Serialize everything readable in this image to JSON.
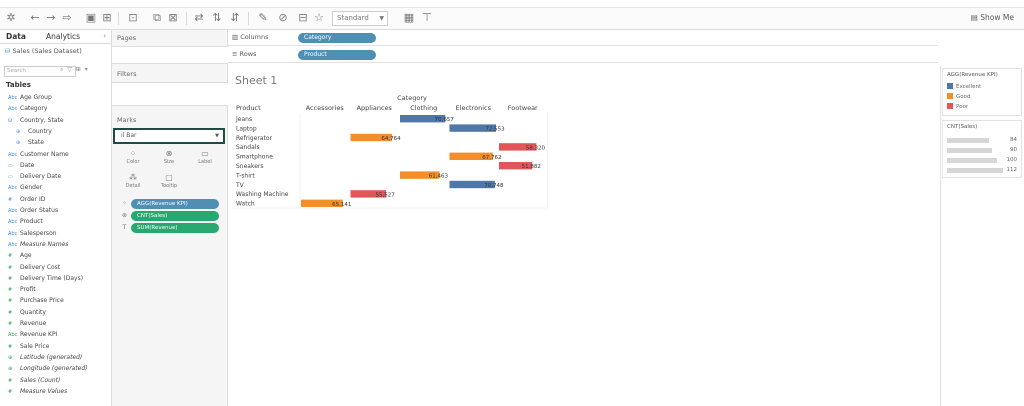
{
  "toolbar": {
    "mark_size": "Standard",
    "show_me": "Show Me"
  },
  "data_pane": {
    "tabs": [
      "Data",
      "Analytics"
    ],
    "datasource": "Sales (Sales Dataset)",
    "search_placeholder": "Search",
    "tables_label": "Tables",
    "fields": [
      {
        "icon": "Abc",
        "name": "Age Group",
        "type": "dim"
      },
      {
        "icon": "Abc",
        "name": "Category",
        "type": "dim"
      },
      {
        "icon": "⛁",
        "name": "Country, State",
        "type": "dim"
      },
      {
        "icon": "⊕",
        "name": "Country",
        "type": "geo"
      },
      {
        "icon": "⊕",
        "name": "State",
        "type": "geo"
      },
      {
        "icon": "Abc",
        "name": "Customer Name",
        "type": "dim"
      },
      {
        "icon": "▭",
        "name": "Date",
        "type": "dim"
      },
      {
        "icon": "▭",
        "name": "Delivery Date",
        "type": "dim"
      },
      {
        "icon": "Abc",
        "name": "Gender",
        "type": "dim"
      },
      {
        "icon": "#",
        "name": "Order ID",
        "type": "dim"
      },
      {
        "icon": "Abc",
        "name": "Order Status",
        "type": "dim"
      },
      {
        "icon": "Abc",
        "name": "Product",
        "type": "dim"
      },
      {
        "icon": "Abc",
        "name": "Salesperson",
        "type": "dim"
      },
      {
        "icon": "Abc",
        "name": "Measure Names",
        "type": "dim",
        "italic": true
      },
      {
        "icon": "#",
        "name": "Age",
        "type": "mea"
      },
      {
        "icon": "#",
        "name": "Delivery Cost",
        "type": "mea"
      },
      {
        "icon": "#",
        "name": "Delivery Time (Days)",
        "type": "mea"
      },
      {
        "icon": "#",
        "name": "Profit",
        "type": "mea"
      },
      {
        "icon": "#",
        "name": "Purchase Price",
        "type": "mea"
      },
      {
        "icon": "#",
        "name": "Quantity",
        "type": "mea"
      },
      {
        "icon": "#",
        "name": "Revenue",
        "type": "mea"
      },
      {
        "icon": "Abc",
        "name": "Revenue KPI",
        "type": "mea"
      },
      {
        "icon": "#",
        "name": "Sale Price",
        "type": "mea"
      },
      {
        "icon": "⊕",
        "name": "Latitude (generated)",
        "type": "mea",
        "italic": true
      },
      {
        "icon": "⊕",
        "name": "Longitude (generated)",
        "type": "mea",
        "italic": true
      },
      {
        "icon": "#",
        "name": "Sales (Count)",
        "type": "mea",
        "italic": true
      },
      {
        "icon": "#",
        "name": "Measure Values",
        "type": "mea",
        "italic": true
      }
    ]
  },
  "cards": {
    "pages": "Pages",
    "filters": "Filters",
    "marks": "Marks",
    "mark_type": "Bar",
    "mark_buttons": [
      "Color",
      "Size",
      "Label",
      "Detail",
      "Tooltip"
    ],
    "mark_pills": [
      "AGG(Revenue KPI)",
      "CNT(Sales)",
      "SUM(Revenue)"
    ]
  },
  "shelves": {
    "columns_label": "Columns",
    "columns_pill": "Category",
    "rows_label": "Rows",
    "rows_pill": "Product"
  },
  "sheet": {
    "title": "Sheet 1",
    "row_header": "Product",
    "col_group_header": "Category"
  },
  "legend": {
    "color_title": "AGG(Revenue KPI)",
    "color_items": [
      {
        "label": "Excellent",
        "color": "#4e79a7"
      },
      {
        "label": "Good",
        "color": "#f28e2b"
      },
      {
        "label": "Poor",
        "color": "#e15759"
      }
    ],
    "size_title": "CNT(Sales)",
    "size_items": [
      "84",
      "90",
      "100",
      "112"
    ]
  },
  "chart_data": {
    "type": "bar",
    "row_field": "Product",
    "col_field": "Category",
    "columns": [
      "Accessories",
      "Appliances",
      "Clothing",
      "Electronics",
      "Footwear"
    ],
    "rows": [
      "Jeans",
      "Laptop",
      "Refrigerator",
      "Sandals",
      "Smartphone",
      "Sneakers",
      "T-shirt",
      "TV",
      "Washing Machine",
      "Watch"
    ],
    "cells": [
      {
        "row": "Jeans",
        "col": "Clothing",
        "value": "70,657",
        "kpi": "Excellent"
      },
      {
        "row": "Laptop",
        "col": "Electronics",
        "value": "72,553",
        "kpi": "Excellent"
      },
      {
        "row": "Refrigerator",
        "col": "Appliances",
        "value": "64,764",
        "kpi": "Good"
      },
      {
        "row": "Sandals",
        "col": "Footwear",
        "value": "58,320",
        "kpi": "Poor"
      },
      {
        "row": "Smartphone",
        "col": "Electronics",
        "value": "67,762",
        "kpi": "Good"
      },
      {
        "row": "Sneakers",
        "col": "Footwear",
        "value": "51,882",
        "kpi": "Poor"
      },
      {
        "row": "T-shirt",
        "col": "Clothing",
        "value": "61,463",
        "kpi": "Good"
      },
      {
        "row": "TV",
        "col": "Electronics",
        "value": "70,748",
        "kpi": "Excellent"
      },
      {
        "row": "Washing Machine",
        "col": "Appliances",
        "value": "55,527",
        "kpi": "Poor"
      },
      {
        "row": "Watch",
        "col": "Accessories",
        "value": "65,141",
        "kpi": "Good"
      }
    ],
    "colors": {
      "Excellent": "#4e79a7",
      "Good": "#f28e2b",
      "Poor": "#e15759"
    }
  }
}
